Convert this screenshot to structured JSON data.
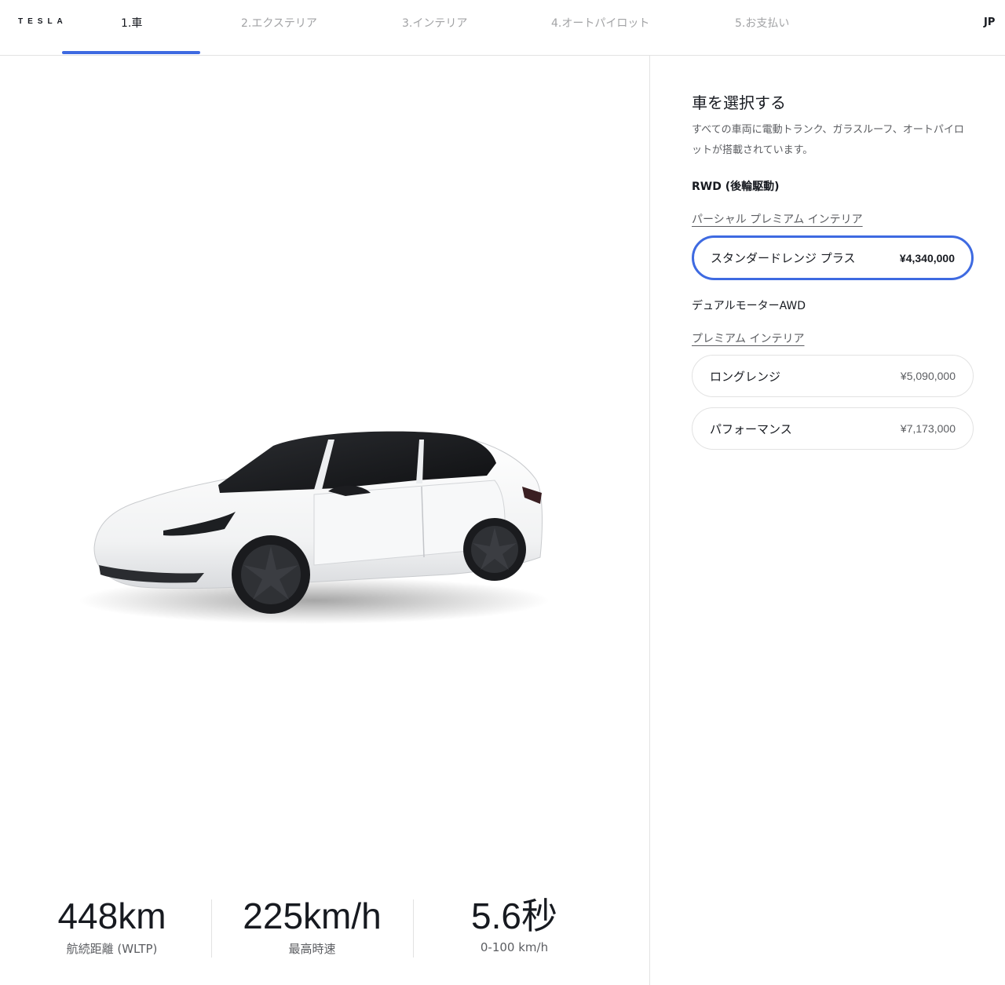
{
  "nav": {
    "logo": "TESLA",
    "steps": [
      {
        "label": "1.車",
        "active": true
      },
      {
        "label": "2.エクステリア",
        "active": false
      },
      {
        "label": "3.インテリア",
        "active": false
      },
      {
        "label": "4.オートパイロット",
        "active": false
      },
      {
        "label": "5.お支払い",
        "active": false
      }
    ],
    "language": "JP"
  },
  "colors": {
    "accent": "#3e6ae1",
    "text": "#171a20",
    "muted": "#5c5e62",
    "border": "#e2e2e2",
    "inactive_step": "#a2a3a5"
  },
  "specs": [
    {
      "value": "448km",
      "label": "航続距離 (WLTP)"
    },
    {
      "value": "225km/h",
      "label": "最高時速"
    },
    {
      "value": "5.6秒",
      "label": "0-100 km/h"
    }
  ],
  "panel": {
    "title": "車を選択する",
    "description": "すべての車両に電動トランク、ガラスルーフ、オートパイロットが搭載されています。",
    "groups": [
      {
        "title": "RWD (後輪駆動)",
        "interior": "パーシャル プレミアム インテリア",
        "options": [
          {
            "name": "スタンダードレンジ プラス",
            "price": "¥4,340,000",
            "selected": true
          }
        ]
      },
      {
        "title": "デュアルモーターAWD",
        "interior": "プレミアム インテリア",
        "options": [
          {
            "name": "ロングレンジ",
            "price": "¥5,090,000",
            "selected": false
          },
          {
            "name": "パフォーマンス",
            "price": "¥7,173,000",
            "selected": false
          }
        ]
      }
    ]
  },
  "car": {
    "color": "white",
    "icon": "car-image"
  }
}
